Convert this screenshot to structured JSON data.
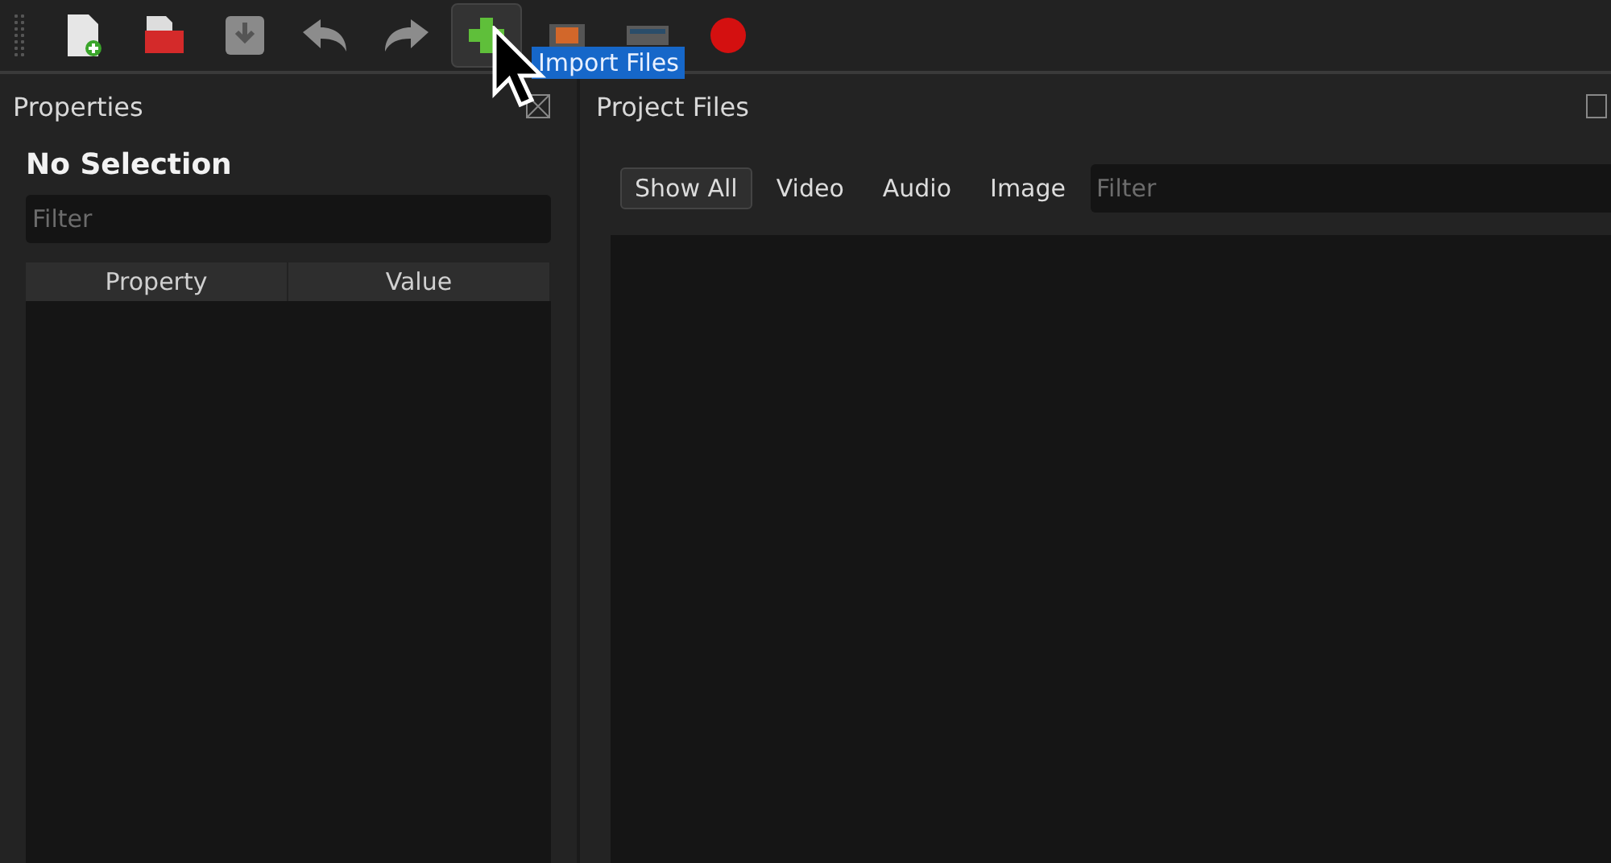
{
  "toolbar": {
    "buttons": [
      {
        "kind": "new",
        "selected": false
      },
      {
        "kind": "open",
        "selected": false
      },
      {
        "kind": "save",
        "selected": false
      },
      {
        "kind": "undo",
        "selected": false
      },
      {
        "kind": "redo",
        "selected": false
      },
      {
        "kind": "import",
        "selected": true
      },
      {
        "kind": "film",
        "selected": false
      },
      {
        "kind": "export",
        "selected": false
      },
      {
        "kind": "record",
        "selected": false
      }
    ],
    "tooltip": "Import Files"
  },
  "properties": {
    "title": "Properties",
    "heading": "No Selection",
    "filter": {
      "placeholder": "Filter"
    },
    "columns": [
      "Property",
      "Value"
    ]
  },
  "project_files": {
    "title": "Project Files",
    "filters": [
      {
        "label": "Show All",
        "selected": true
      },
      {
        "label": "Video",
        "selected": false
      },
      {
        "label": "Audio",
        "selected": false
      },
      {
        "label": "Image",
        "selected": false
      }
    ],
    "filter": {
      "placeholder": "Filter"
    }
  }
}
